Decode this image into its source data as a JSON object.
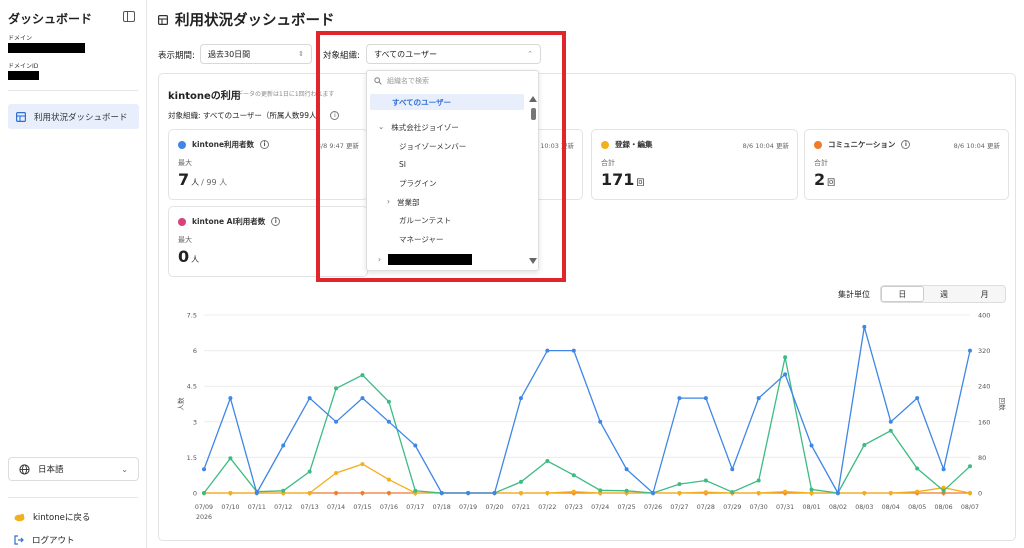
{
  "sidebar": {
    "title": "ダッシュボード",
    "domain_label": "ドメイン",
    "domain_id_label": "ドメインID",
    "nav_item": "利用状況ダッシュボード",
    "language": "日本語",
    "back_link": "kintoneに戻る",
    "logout": "ログアウト"
  },
  "header": {
    "title": "利用状況ダッシュボード",
    "period_label": "表示期間:",
    "period_value": "過去30日間",
    "org_label": "対象組織:",
    "org_value": "すべてのユーザー"
  },
  "dropdown": {
    "search_placeholder": "組織名で検索",
    "all_users": "すべてのユーザー",
    "company": "株式会社ジョイゾー",
    "items": [
      "ジョイゾーメンバー",
      "SI",
      "プラグイン",
      "営業部",
      "ガルーンテスト",
      "マネージャー"
    ]
  },
  "section": {
    "title": "kintoneの利用",
    "note": "データの更新は1日に1回行われます",
    "target_prefix": "対象組織: すべてのユーザー（所属人数99人"
  },
  "cards": [
    {
      "title": "kintone利用者数",
      "updated": "8/8 9:47 更新",
      "sub": "最大",
      "value": "7",
      "unit": "人",
      "of": "/ 99 人",
      "color": "#3f86e6"
    },
    {
      "title": "",
      "updated": "10:03 更新",
      "sub": "",
      "value": "",
      "unit": "",
      "of": "",
      "color": ""
    },
    {
      "title": "登録・編集",
      "updated": "8/6 10:04 更新",
      "sub": "合計",
      "value": "171",
      "unit": "回",
      "of": "",
      "color": "#f2b01e"
    },
    {
      "title": "コミュニケーション",
      "updated": "8/6 10:04 更新",
      "sub": "合計",
      "value": "2",
      "unit": "回",
      "of": "",
      "color": "#f07b2a"
    },
    {
      "title": "kintone AI利用者数",
      "updated": "",
      "sub": "最大",
      "value": "0",
      "unit": "人",
      "of": "",
      "color": "#d8417b"
    }
  ],
  "aggregation": {
    "label": "集計単位",
    "options": [
      "日",
      "週",
      "月"
    ],
    "selected": "日"
  },
  "colors": {
    "accent": "#2f6fd6",
    "red_highlight": "#e1262b"
  },
  "chart_data": {
    "type": "line",
    "x": [
      "07/09",
      "07/10",
      "07/11",
      "07/12",
      "07/13",
      "07/14",
      "07/15",
      "07/16",
      "07/17",
      "07/18",
      "07/19",
      "07/20",
      "07/21",
      "07/22",
      "07/23",
      "07/24",
      "07/25",
      "07/26",
      "07/27",
      "07/28",
      "07/29",
      "07/30",
      "07/31",
      "08/01",
      "08/02",
      "08/03",
      "08/04",
      "08/05",
      "08/06",
      "08/07"
    ],
    "x_year_label": "2026",
    "ylabel": "人数",
    "y2label": "回数",
    "ylim": [
      0,
      7.5
    ],
    "y2lim": [
      0,
      400
    ],
    "yticks": [
      "0",
      "1.5",
      "3",
      "4.5",
      "6",
      "7.5"
    ],
    "y2ticks": [
      "0",
      "80",
      "160",
      "240",
      "320",
      "400"
    ],
    "series": [
      {
        "axis": "left",
        "color": "#3f86e6",
        "values": [
          1,
          4,
          0,
          2,
          4,
          3,
          4,
          3,
          2,
          0,
          0,
          0,
          4,
          6,
          6,
          3,
          1,
          0,
          4,
          4,
          1,
          4,
          5,
          2,
          0,
          7,
          3,
          4,
          1,
          6
        ]
      },
      {
        "axis": "right",
        "color": "#3dbb84",
        "values": [
          0,
          78,
          3,
          5,
          48,
          235,
          265,
          205,
          5,
          0,
          0,
          0,
          25,
          72,
          40,
          6,
          5,
          0,
          20,
          28,
          2,
          28,
          305,
          8,
          0,
          108,
          140,
          55,
          5,
          60
        ]
      },
      {
        "axis": "right",
        "color": "#f2b01e",
        "values": [
          0,
          0,
          0,
          0,
          0,
          45,
          65,
          30,
          0,
          0,
          0,
          0,
          0,
          0,
          3,
          0,
          0,
          0,
          0,
          2,
          0,
          0,
          3,
          0,
          0,
          0,
          0,
          3,
          12,
          0
        ]
      },
      {
        "axis": "right",
        "color": "#f07b2a",
        "values": [
          0,
          0,
          0,
          0,
          0,
          0,
          0,
          0,
          0,
          0,
          0,
          0,
          0,
          0,
          0,
          0,
          0,
          0,
          0,
          0,
          0,
          0,
          0,
          0,
          0,
          0,
          0,
          0,
          0,
          0
        ]
      }
    ]
  }
}
